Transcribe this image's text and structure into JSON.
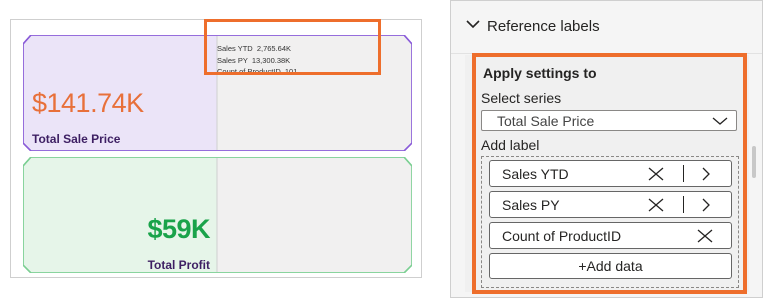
{
  "kpi_cards": [
    {
      "value": "$141.74K",
      "label": "Total Sale Price",
      "reference_labels": [
        {
          "name": "Sales YTD",
          "value": "2,765.64K"
        },
        {
          "name": "Sales PY",
          "value": "13,300.38K"
        },
        {
          "name": "Count of ProductID",
          "value": "101"
        }
      ],
      "colors": {
        "value": "#e8703a",
        "label": "#3d1f63",
        "border": "#8a5cd8",
        "fill": "#ebe4f8"
      }
    },
    {
      "value": "$59K",
      "label": "Total Profit",
      "colors": {
        "value": "#19a34a",
        "label": "#3d1f63",
        "border": "#7ccf93",
        "fill": "#e6f5e9"
      }
    }
  ],
  "format_pane": {
    "section_title": "Reference labels",
    "apply_settings_title": "Apply settings to",
    "select_series_label": "Select series",
    "selected_series": "Total Sale Price",
    "add_label_title": "Add label",
    "labels": [
      {
        "text": "Sales YTD",
        "icons": [
          "close-icon",
          "chevron-right-icon"
        ]
      },
      {
        "text": "Sales PY",
        "icons": [
          "close-icon",
          "chevron-right-icon"
        ]
      },
      {
        "text": "Count of ProductID",
        "icons": [
          "close-icon"
        ]
      }
    ],
    "add_data_button": "+Add data"
  },
  "highlight_color": "#ee6e2c"
}
